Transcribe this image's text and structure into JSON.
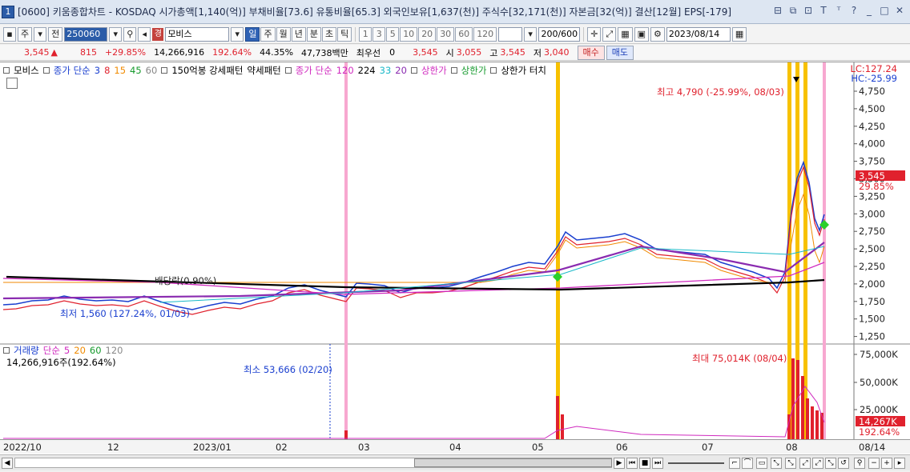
{
  "window": {
    "number": "1",
    "title": "[0600] 키움종합차트 - KOSDAQ 시가총액[1,140(억)] 부채비율[73.6] 유통비율[65.3] 외국인보유[1,637(천)] 주식수[32,171(천)] 자본금[32(억)] 결산[12월] EPS[-179]"
  },
  "toolbar": {
    "period_main": "주",
    "prev_label": "전",
    "stock_code": "250060",
    "stock_name": "모비스",
    "badge": "경",
    "periods": [
      "일",
      "주",
      "월",
      "년",
      "분",
      "초",
      "틱"
    ],
    "numbers": [
      "1",
      "3",
      "5",
      "10",
      "20",
      "30",
      "60",
      "120"
    ],
    "count": "200/600",
    "date": "2023/08/14"
  },
  "quote": {
    "price": "3,545",
    "change": "815",
    "change_pct": "+29.85%",
    "volume": "14,266,916",
    "vol_ratio": "192.64%",
    "turnover": "44.35%",
    "amount": "47,738백만",
    "pref_label": "최우선",
    "pref_value": "0",
    "ask": "3,545",
    "open_label": "시",
    "open": "3,055",
    "high_label": "고",
    "high": "3,545",
    "low_label": "저",
    "low": "3,040",
    "buy_label": "매수",
    "sell_label": "매도"
  },
  "legend": {
    "name": "모비스",
    "ma_label": "종가 단순",
    "ma_periods": [
      "3",
      "8",
      "15",
      "45",
      "60"
    ],
    "pattern1": "150억봉 강세패턴",
    "pattern2": "약세패턴",
    "ma2_label": "종가 단순",
    "ma2_periods": [
      "120",
      "224",
      "33",
      "20"
    ],
    "limit_up": "상한가",
    "limit_up2": "상한가",
    "limit_touch": "상한가 터치",
    "lc": "LC:127.24",
    "hc": "HC:-25.99"
  },
  "volume_legend": {
    "label": "거래량",
    "ma_label": "단순",
    "periods": [
      "5",
      "20",
      "60",
      "120"
    ],
    "current": "14,266,916주(192.64%)"
  },
  "annotations": {
    "high": "최고 4,790 (-25.99%, 08/03)",
    "low": "최저 1,560 (127.24%, 01/03)",
    "dividend": "배당락(0.90%)",
    "vol_max": "최대 75,014K (08/04)",
    "vol_min": "최소 53,666 (02/20)",
    "price_tag": "3,545",
    "pct_tag": "29.85%",
    "vol_tag": "14,267K",
    "vol_pct_tag": "192.64%"
  },
  "price_axis": [
    "4,750",
    "4,500",
    "4,250",
    "4,000",
    "3,750",
    "3,500",
    "3,250",
    "3,000",
    "2,750",
    "2,500",
    "2,250",
    "2,000",
    "1,750",
    "1,500",
    "1,250"
  ],
  "volume_axis": [
    "75,000K",
    "50,000K",
    "25,000K"
  ],
  "x_axis": [
    "2022/10",
    "12",
    "2023/01",
    "02",
    "03",
    "04",
    "05",
    "06",
    "07",
    "08",
    "08/14"
  ],
  "colors": {
    "up": "#e0212d",
    "down": "#1a3fcf",
    "limit_up_marker": "#f7c100",
    "pattern_marker": "#f7a8d0"
  }
}
